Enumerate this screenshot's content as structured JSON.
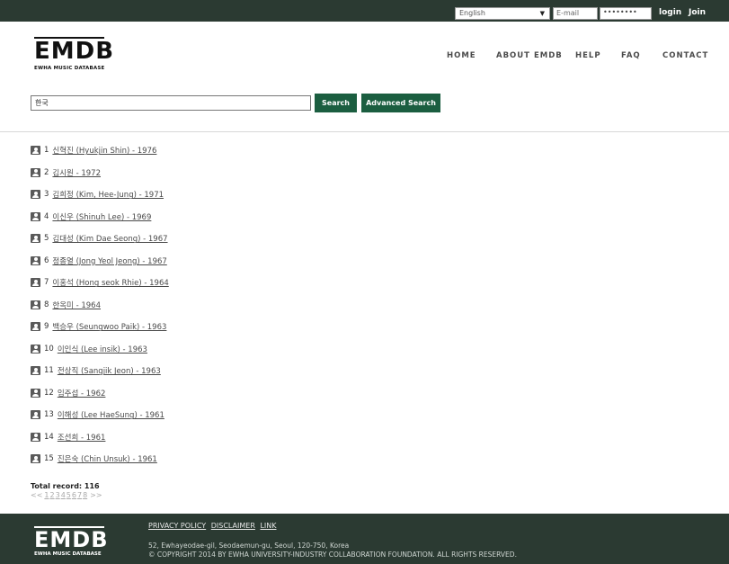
{
  "topbar": {
    "language": "English",
    "email_placeholder": "E-mail",
    "password_mask": "••••••••",
    "login_label": "login",
    "join_label": "Join"
  },
  "logo": {
    "title": "EMDB",
    "subtitle": "EWHA MUSIC DATABASE"
  },
  "nav": {
    "home": "HOME",
    "about": "ABOUT EMDB",
    "help": "HELP",
    "faq": "FAQ",
    "contact": "CONTACT"
  },
  "search": {
    "value": "한국",
    "search_label": "Search",
    "advanced_label": "Advanced Search"
  },
  "results": [
    {
      "num": "1",
      "text": "신혁진 (Hyukjin Shin)  - 1976"
    },
    {
      "num": "2",
      "text": "김시원  - 1972"
    },
    {
      "num": "3",
      "text": "김희정 (Kim, Hee-Jung)  - 1971"
    },
    {
      "num": "4",
      "text": "이신우 (Shinuh Lee)  - 1969"
    },
    {
      "num": "5",
      "text": "김대성 (Kim Dae Seong)  - 1967"
    },
    {
      "num": "6",
      "text": "정종열 (Jong Yeol Jeong)  - 1967"
    },
    {
      "num": "7",
      "text": "이홍석 (Hong seok Rhie)  - 1964"
    },
    {
      "num": "8",
      "text": "한옥미  - 1964"
    },
    {
      "num": "9",
      "text": "백승우 (Seungwoo Paik)  - 1963"
    },
    {
      "num": "10",
      "text": "이인식 (Lee insik)  - 1963"
    },
    {
      "num": "11",
      "text": "전상직 (Sangjik Jeon)  - 1963"
    },
    {
      "num": "12",
      "text": "임주섭  - 1962"
    },
    {
      "num": "13",
      "text": "이해성 (Lee HaeSung)  - 1961"
    },
    {
      "num": "14",
      "text": "조선희  - 1961"
    },
    {
      "num": "15",
      "text": "진은숙 (Chin Unsuk)  - 1961"
    }
  ],
  "total": "Total record: 116",
  "pager": {
    "prev": "<<",
    "pages": [
      "1",
      "2",
      "3",
      "4",
      "5",
      "6",
      "7",
      "8"
    ],
    "next": ">>"
  },
  "footer": {
    "logo_title": "EMDB",
    "logo_subtitle": "EWHA MUSIC DATABASE",
    "links": [
      "PRIVACY POLICY",
      "DISCLAIMER",
      "LINK"
    ],
    "address": "52, Ewhayeodae-gil, Seodaemun-gu, Seoul, 120-750, Korea",
    "copyright": "© COPYRIGHT 2014 BY EWHA UNIVERSITY-INDUSTRY COLLABORATION FOUNDATION. ALL RIGHTS RESERVED."
  }
}
